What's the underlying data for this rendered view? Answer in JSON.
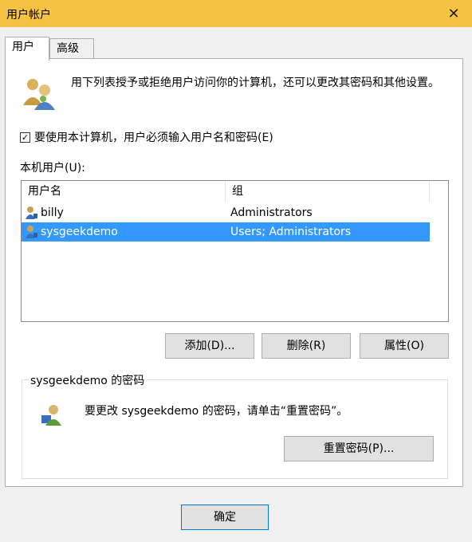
{
  "window": {
    "title": "用户帐户",
    "close_glyph": "✕"
  },
  "tabs": [
    {
      "label": "用户",
      "active": true
    },
    {
      "label": "高级",
      "active": false
    }
  ],
  "intro": {
    "text": "用下列表授予或拒绝用户访问你的计算机，还可以更改其密码和其他设置。",
    "icon": "users-group-icon"
  },
  "require_login": {
    "label": "要使用本计算机，用户必须输入用户名和密码(E)",
    "checked": true,
    "check_glyph": "✓"
  },
  "local_users": {
    "label": "本机用户(U):",
    "columns": [
      "用户名",
      "组"
    ],
    "rows": [
      {
        "name": "billy",
        "group": "Administrators",
        "selected": false
      },
      {
        "name": "sysgeekdemo",
        "group": "Users; Administrators",
        "selected": true
      }
    ]
  },
  "buttons": {
    "add": "添加(D)...",
    "delete": "删除(R)",
    "properties": "属性(O)"
  },
  "password_group": {
    "legend": "sysgeekdemo 的密码",
    "text": "要更改 sysgeekdemo 的密码，请单击“重置密码”。",
    "reset_button": "重置密码(P)..."
  },
  "footer": {
    "ok_button": "确定"
  },
  "colors": {
    "titlebar": "#f6c241",
    "selection": "#3399ff"
  }
}
